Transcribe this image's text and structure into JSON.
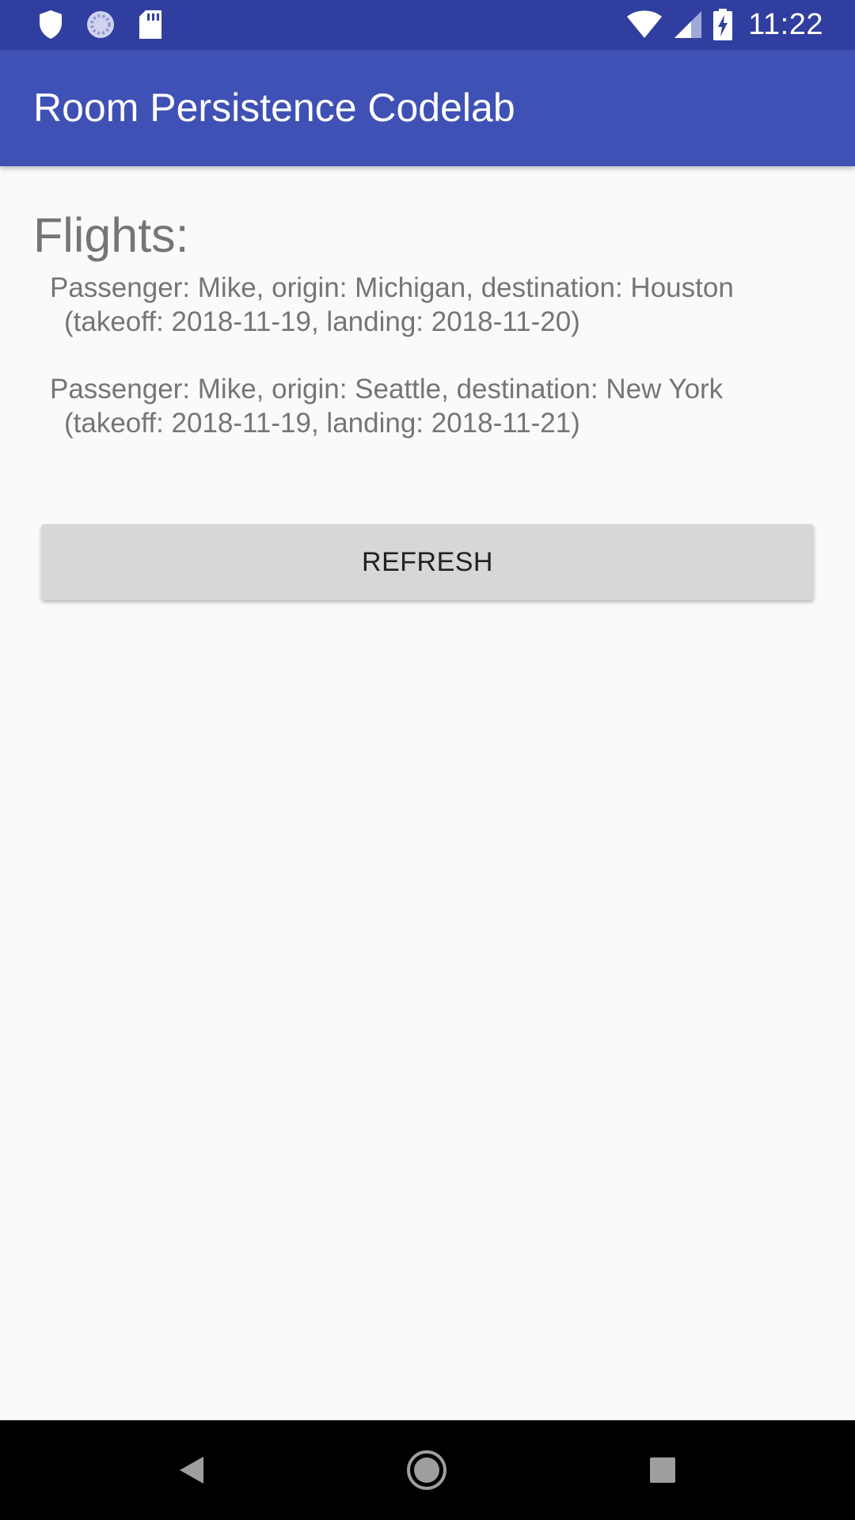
{
  "status_bar": {
    "time": "11:22",
    "background_color": "#303f9f",
    "left_icons": [
      "shield-icon",
      "sync-icon",
      "sd-card-icon"
    ],
    "right_icons": [
      "wifi-icon",
      "cell-signal-icon",
      "battery-charging-icon"
    ]
  },
  "app_bar": {
    "title": "Room Persistence Codelab",
    "background_color": "#3f51b5"
  },
  "main": {
    "heading": "Flights:",
    "flights": [
      {
        "line1": "Passenger: Mike, origin: Michigan, destination: Houston",
        "line2": "(takeoff: 2018-11-19, landing: 2018-11-20)"
      },
      {
        "line1": "Passenger: Mike, origin: Seattle, destination: New York",
        "line2": "(takeoff: 2018-11-19, landing: 2018-11-21)"
      }
    ],
    "refresh_label": "REFRESH"
  },
  "nav_bar": {
    "icons": [
      "back-icon",
      "home-icon",
      "recents-icon"
    ]
  }
}
